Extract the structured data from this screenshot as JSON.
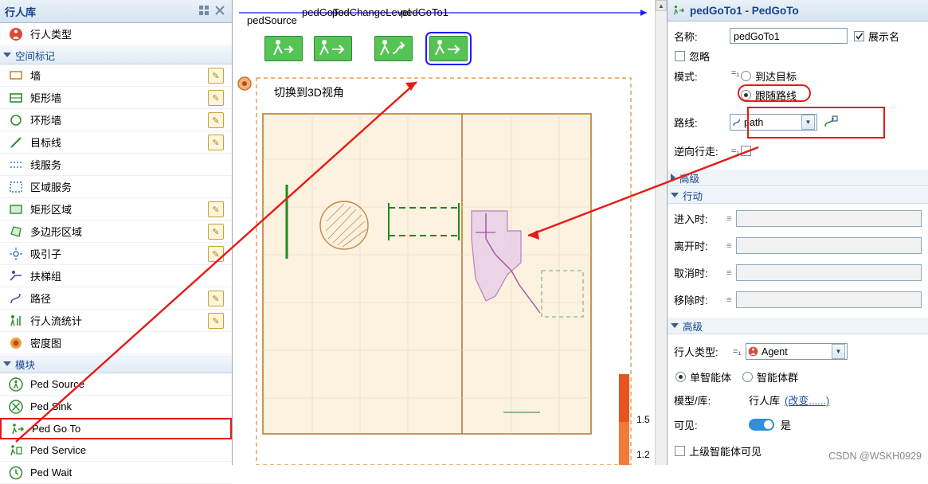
{
  "palette": {
    "title": "行人库",
    "header_icons": [
      "grid-icon",
      "close-icon"
    ],
    "sections": [
      {
        "label": "行人类型",
        "type": "item",
        "icon": "person-type-icon"
      },
      {
        "label": "空间标记",
        "type": "group",
        "expanded": true
      }
    ],
    "space_markup_items": [
      {
        "label": "墙",
        "icon": "wall-icon",
        "pencil": true
      },
      {
        "label": "矩形墙",
        "icon": "rect-wall-icon",
        "pencil": true
      },
      {
        "label": "环形墙",
        "icon": "circular-wall-icon",
        "pencil": true
      },
      {
        "label": "目标线",
        "icon": "target-line-icon",
        "pencil": true
      },
      {
        "label": "线服务",
        "icon": "line-service-icon",
        "pencil": false
      },
      {
        "label": "区域服务",
        "icon": "area-service-icon",
        "pencil": false
      },
      {
        "label": "矩形区域",
        "icon": "rect-area-icon",
        "pencil": true
      },
      {
        "label": "多边形区域",
        "icon": "polygon-area-icon",
        "pencil": true
      },
      {
        "label": "吸引子",
        "icon": "attractor-icon",
        "pencil": true
      },
      {
        "label": "扶梯组",
        "icon": "escalator-group-icon",
        "pencil": false
      },
      {
        "label": "路径",
        "icon": "path-icon",
        "pencil": true
      },
      {
        "label": "行人流统计",
        "icon": "ped-flow-statistics-icon",
        "pencil": true
      },
      {
        "label": "密度图",
        "icon": "density-map-icon",
        "pencil": false
      }
    ],
    "module_group_label": "模块",
    "module_items": [
      {
        "label": "Ped Source",
        "icon": "ped-source-icon",
        "highlighted": false
      },
      {
        "label": "Ped Sink",
        "icon": "ped-sink-icon",
        "highlighted": false
      },
      {
        "label": "Ped Go To",
        "icon": "ped-go-to-icon",
        "highlighted": true
      },
      {
        "label": "Ped Service",
        "icon": "ped-service-icon",
        "highlighted": false
      },
      {
        "label": "Ped Wait",
        "icon": "ped-wait-icon",
        "highlighted": false
      }
    ]
  },
  "canvas": {
    "block_labels": [
      "pedSource",
      "pedGoTo",
      "pedChangeLevel",
      "pedGoTo1"
    ],
    "view_link": "切换到3D视角",
    "ruler_marks": [
      "1.5",
      "1.2"
    ]
  },
  "properties": {
    "header_title": "pedGoTo1 - PedGoTo",
    "header_icon": "ped-go-to-icon",
    "name_label": "名称:",
    "name_value": "pedGoTo1",
    "show_label": "展示名",
    "show_checked": true,
    "ignore_label": "忽略",
    "ignore_checked": false,
    "mode_label": "模式:",
    "mode_options": [
      "到达目标",
      "跟随路线"
    ],
    "mode_selected": "跟随路线",
    "route_label": "路线:",
    "route_value": "path",
    "route_button_icon": "edit-route-icon",
    "reverse_label": "逆向行走:",
    "reverse_checked": false,
    "advanced_label_1": "高级",
    "action_label": "行动",
    "actions": [
      {
        "label": "进入时:",
        "value": ""
      },
      {
        "label": "离开时:",
        "value": ""
      },
      {
        "label": "取消时:",
        "value": ""
      },
      {
        "label": "移除时:",
        "value": ""
      }
    ],
    "advanced_label_2": "高级",
    "ped_type_label": "行人类型:",
    "ped_type_value": "Agent",
    "ped_type_icon": "agent-icon",
    "single_agent_label": "单智能体",
    "agent_group_label": "智能体群",
    "agent_mode_selected": "单智能体",
    "model_lib_label": "模型/库:",
    "model_lib_value": "行人库",
    "model_lib_change": "(改变......)",
    "visible_label": "可见:",
    "visible_value": "是",
    "visible_on": true,
    "upper_agent_label": "上级智能体可见",
    "upper_agent_checked": false
  },
  "watermark": "CSDN @WSKH0929"
}
